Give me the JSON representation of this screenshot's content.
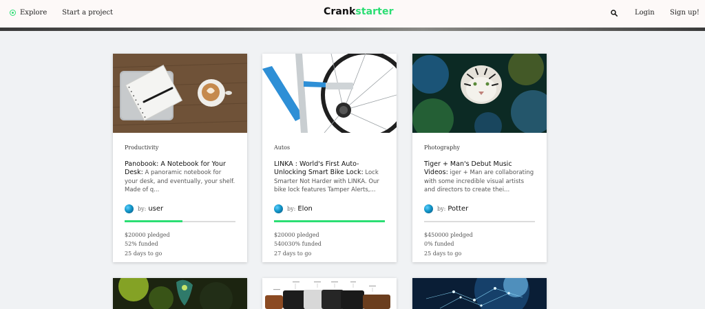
{
  "nav": {
    "explore": "Explore",
    "start": "Start a project",
    "login": "Login",
    "signup": "Sign up!"
  },
  "logo": {
    "part1": "Crank",
    "part2": "starter"
  },
  "colors": {
    "accent": "#2bde73"
  },
  "cards": [
    {
      "category": "Productivity",
      "title": "Panobook: A Notebook for Your Desk:",
      "blurb": " A panoramic notebook for your desk, and eventually, your shelf. Made of q...",
      "by_label": "by:",
      "author": "user",
      "progress": 0.52,
      "pledged": "$20000 pledged",
      "funded": "52% funded",
      "days": "25 days to go"
    },
    {
      "category": "Autos",
      "title": "LINKA : World's First Auto-Unlocking Smart Bike Lock:",
      "blurb": " Lock Smarter Not Harder with LINKA. Our bike lock features Tamper Alerts,...",
      "by_label": "by:",
      "author": "Elon",
      "progress": 1.0,
      "pledged": "$20000 pledged",
      "funded": "540030% funded",
      "days": "27 days to go"
    },
    {
      "category": "Photography",
      "title": "Tiger + Man's Debut Music Videos:",
      "blurb": " iger + Man are collaborating with some incredible visual artists and directors to create thei...",
      "by_label": "by:",
      "author": "Potter",
      "progress": 0.0,
      "pledged": "$450000 pledged",
      "funded": "0% funded",
      "days": "25 days to go"
    }
  ]
}
